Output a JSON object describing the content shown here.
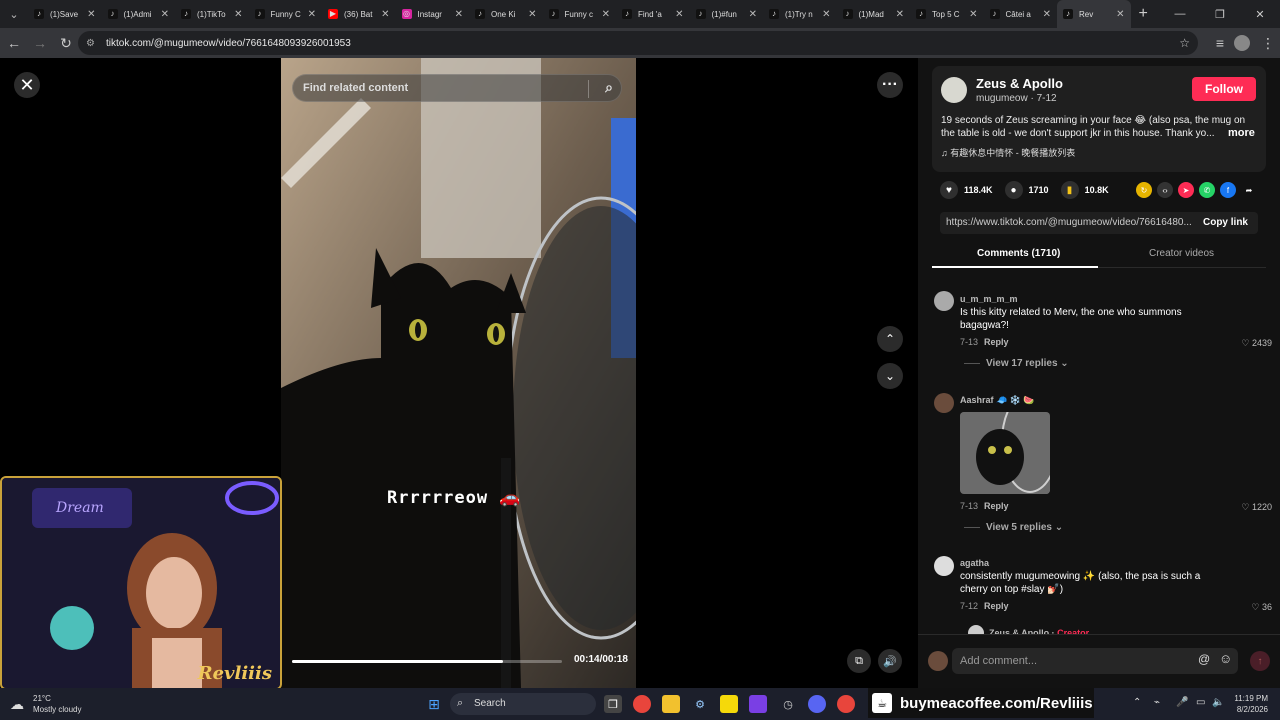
{
  "browser": {
    "tabs": [
      {
        "title": "(1)Save",
        "favicon": "tiktok-icon",
        "active": false
      },
      {
        "title": "(1)Admi",
        "favicon": "tiktok-icon",
        "active": false
      },
      {
        "title": "(1)TikTo",
        "favicon": "tiktok-icon",
        "active": false
      },
      {
        "title": "Funny C",
        "favicon": "tiktok-icon",
        "active": false
      },
      {
        "title": "(36) Bat",
        "favicon": "youtube-icon",
        "active": false
      },
      {
        "title": "Instagr",
        "favicon": "instagram-icon",
        "active": false
      },
      {
        "title": "One Ki",
        "favicon": "tiktok-icon",
        "active": false
      },
      {
        "title": "Funny c",
        "favicon": "tiktok-icon",
        "active": false
      },
      {
        "title": "Find 'a",
        "favicon": "tiktok-icon",
        "active": false
      },
      {
        "title": "(1)#fun",
        "favicon": "tiktok-icon",
        "active": false
      },
      {
        "title": "(1)Try n",
        "favicon": "tiktok-icon",
        "active": false
      },
      {
        "title": "(1)Mad",
        "favicon": "tiktok-icon",
        "active": false
      },
      {
        "title": "Top 5 C",
        "favicon": "tiktok-icon",
        "active": false
      },
      {
        "title": "Câtei a",
        "favicon": "tiktok-icon",
        "active": false
      },
      {
        "title": "Rev",
        "favicon": "tiktok-icon",
        "active": true
      }
    ],
    "url": "tiktok.com/@mugumeow/video/7661648093926001953"
  },
  "video": {
    "search_placeholder": "Find related content",
    "caption": "Rrrrrreow 🚗",
    "time": "00:14/00:18",
    "progress": 0.78
  },
  "overlay": {
    "brand": "Revliiis",
    "sign_text": "Dream"
  },
  "post": {
    "author_name": "Zeus & Apollo",
    "author_meta": "mugumeow · 7-12",
    "follow_label": "Follow",
    "description": "19 seconds of Zeus screaming in your face 😂 (also psa, the mug on the table is old - we don't support jkr in this house. Thank yo...",
    "more_label": "more",
    "music": "有趣休息中情怀 - 晚餐播放列表",
    "likes": "118.4K",
    "comments": "1710",
    "saves": "10.8K",
    "share_link": "https://www.tiktok.com/@mugumeow/video/76616480...",
    "copy_label": "Copy link"
  },
  "panel_tabs": {
    "comments": "Comments (1710)",
    "creator": "Creator videos"
  },
  "comments": [
    {
      "user": "u_m_m_m_m",
      "text": "Is this kitty related to Merv, the one who summons bagagwa?!",
      "date": "7-13",
      "reply": "Reply",
      "likes": "2439",
      "view_replies": "View 17 replies"
    },
    {
      "user": "Aashraf 🧢 ❄️ 🍉",
      "text": "",
      "date": "7-13",
      "reply": "Reply",
      "likes": "1220",
      "view_replies": "View 5 replies"
    },
    {
      "user": "agatha",
      "text": "consistently mugumeowing ✨ (also, the psa is such a cherry on top #slay 💅🏻)",
      "date": "7-12",
      "reply": "Reply",
      "likes": "36"
    }
  ],
  "partial_reply": {
    "user": "Zeus & Apollo",
    "tag": "Creator"
  },
  "add_comment_placeholder": "Add comment...",
  "taskbar": {
    "temp": "21°C",
    "weather": "Mostly cloudy",
    "search": "Search",
    "bmc": "buymeacoffee.com/Revliiis",
    "time": "11:19 PM",
    "date": "8/2/2026"
  },
  "colors": {
    "follow": "#fe2c55",
    "panel_bg": "#121212",
    "browser_bg": "#202124"
  }
}
